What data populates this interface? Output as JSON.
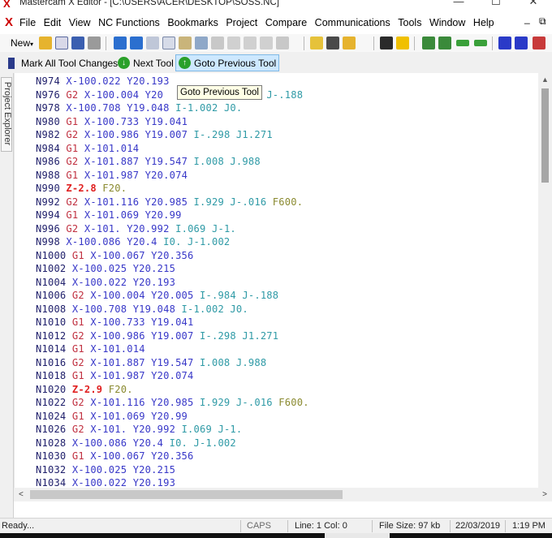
{
  "window": {
    "app_icon_glyph": "X",
    "title": "Mastercam X Editor - [C:\\USERS\\ACER\\DESKTOP\\SOSS.NC]",
    "minimize_glyph": "—",
    "maximize_glyph": "☐",
    "close_glyph": "✕"
  },
  "menubar": {
    "doc_icon_glyph": "X",
    "items": [
      "File",
      "Edit",
      "View",
      "NC Functions",
      "Bookmarks",
      "Project",
      "Compare",
      "Communications",
      "Tools",
      "Window",
      "Help"
    ],
    "doc_minimize_glyph": "_",
    "doc_restore_glyph": "⧉"
  },
  "toolbar": {
    "new_label": "New",
    "new_arrow": "▾"
  },
  "toolbar2": {
    "mark_all_label": "Mark All Tool Changes",
    "next_tool_label": "Next Tool",
    "goto_previous_label": "Goto Previous Tool",
    "next_icon_glyph": "↓",
    "previous_icon_glyph": "↑"
  },
  "tooltip": {
    "text": "Goto Previous Tool"
  },
  "side_panel": {
    "tab_label": "Project Explorer"
  },
  "code": {
    "lines": [
      [
        {
          "t": "N974",
          "c": "c-n"
        },
        {
          "t": " X-100.022",
          "c": "c-x"
        },
        {
          "t": " Y20.193",
          "c": "c-y"
        }
      ],
      [
        {
          "t": "N976",
          "c": "c-n"
        },
        {
          "t": " G2",
          "c": "c-g"
        },
        {
          "t": " X-100.004",
          "c": "c-x"
        },
        {
          "t": " Y20",
          "c": "c-y"
        },
        {
          "t": "                 ",
          "c": "c-n"
        },
        {
          "t": "J-.188",
          "c": "c-i"
        }
      ],
      [
        {
          "t": "N978",
          "c": "c-n"
        },
        {
          "t": " X-100.708",
          "c": "c-x"
        },
        {
          "t": " Y19.048",
          "c": "c-y"
        },
        {
          "t": " I-1.002 J0.",
          "c": "c-i"
        }
      ],
      [
        {
          "t": "N980",
          "c": "c-n"
        },
        {
          "t": " G1",
          "c": "c-g"
        },
        {
          "t": " X-100.733",
          "c": "c-x"
        },
        {
          "t": " Y19.041",
          "c": "c-y"
        }
      ],
      [
        {
          "t": "N982",
          "c": "c-n"
        },
        {
          "t": " G2",
          "c": "c-g"
        },
        {
          "t": " X-100.986",
          "c": "c-x"
        },
        {
          "t": " Y19.007",
          "c": "c-y"
        },
        {
          "t": " I-.298 J1.271",
          "c": "c-i"
        }
      ],
      [
        {
          "t": "N984",
          "c": "c-n"
        },
        {
          "t": " G1",
          "c": "c-g"
        },
        {
          "t": " X-101.014",
          "c": "c-x"
        }
      ],
      [
        {
          "t": "N986",
          "c": "c-n"
        },
        {
          "t": " G2",
          "c": "c-g"
        },
        {
          "t": " X-101.887",
          "c": "c-x"
        },
        {
          "t": " Y19.547",
          "c": "c-y"
        },
        {
          "t": " I.008 J.988",
          "c": "c-i"
        }
      ],
      [
        {
          "t": "N988",
          "c": "c-n"
        },
        {
          "t": " G1",
          "c": "c-g"
        },
        {
          "t": " X-101.987",
          "c": "c-x"
        },
        {
          "t": " Y20.074",
          "c": "c-y"
        }
      ],
      [
        {
          "t": "N990",
          "c": "c-n"
        },
        {
          "t": " Z-2.8",
          "c": "c-z"
        },
        {
          "t": " F20.",
          "c": "c-f"
        }
      ],
      [
        {
          "t": "N992",
          "c": "c-n"
        },
        {
          "t": " G2",
          "c": "c-g"
        },
        {
          "t": " X-101.116",
          "c": "c-x"
        },
        {
          "t": " Y20.985",
          "c": "c-y"
        },
        {
          "t": " I.929 J-.016",
          "c": "c-i"
        },
        {
          "t": " F600.",
          "c": "c-f"
        }
      ],
      [
        {
          "t": "N994",
          "c": "c-n"
        },
        {
          "t": " G1",
          "c": "c-g"
        },
        {
          "t": " X-101.069",
          "c": "c-x"
        },
        {
          "t": " Y20.99",
          "c": "c-y"
        }
      ],
      [
        {
          "t": "N996",
          "c": "c-n"
        },
        {
          "t": " G2",
          "c": "c-g"
        },
        {
          "t": " X-101.",
          "c": "c-x"
        },
        {
          "t": " Y20.992",
          "c": "c-y"
        },
        {
          "t": " I.069 J-1.",
          "c": "c-i"
        }
      ],
      [
        {
          "t": "N998",
          "c": "c-n"
        },
        {
          "t": " X-100.086",
          "c": "c-x"
        },
        {
          "t": " Y20.4",
          "c": "c-y"
        },
        {
          "t": " I0. J-1.002",
          "c": "c-i"
        }
      ],
      [
        {
          "t": "N1000",
          "c": "c-n"
        },
        {
          "t": " G1",
          "c": "c-g"
        },
        {
          "t": " X-100.067",
          "c": "c-x"
        },
        {
          "t": " Y20.356",
          "c": "c-y"
        }
      ],
      [
        {
          "t": "N1002",
          "c": "c-n"
        },
        {
          "t": " X-100.025",
          "c": "c-x"
        },
        {
          "t": " Y20.215",
          "c": "c-y"
        }
      ],
      [
        {
          "t": "N1004",
          "c": "c-n"
        },
        {
          "t": " X-100.022",
          "c": "c-x"
        },
        {
          "t": " Y20.193",
          "c": "c-y"
        }
      ],
      [
        {
          "t": "N1006",
          "c": "c-n"
        },
        {
          "t": " G2",
          "c": "c-g"
        },
        {
          "t": " X-100.004",
          "c": "c-x"
        },
        {
          "t": " Y20.005",
          "c": "c-y"
        },
        {
          "t": " I-.984 J-.188",
          "c": "c-i"
        }
      ],
      [
        {
          "t": "N1008",
          "c": "c-n"
        },
        {
          "t": " X-100.708",
          "c": "c-x"
        },
        {
          "t": " Y19.048",
          "c": "c-y"
        },
        {
          "t": " I-1.002 J0.",
          "c": "c-i"
        }
      ],
      [
        {
          "t": "N1010",
          "c": "c-n"
        },
        {
          "t": " G1",
          "c": "c-g"
        },
        {
          "t": " X-100.733",
          "c": "c-x"
        },
        {
          "t": " Y19.041",
          "c": "c-y"
        }
      ],
      [
        {
          "t": "N1012",
          "c": "c-n"
        },
        {
          "t": " G2",
          "c": "c-g"
        },
        {
          "t": " X-100.986",
          "c": "c-x"
        },
        {
          "t": " Y19.007",
          "c": "c-y"
        },
        {
          "t": " I-.298 J1.271",
          "c": "c-i"
        }
      ],
      [
        {
          "t": "N1014",
          "c": "c-n"
        },
        {
          "t": " G1",
          "c": "c-g"
        },
        {
          "t": " X-101.014",
          "c": "c-x"
        }
      ],
      [
        {
          "t": "N1016",
          "c": "c-n"
        },
        {
          "t": " G2",
          "c": "c-g"
        },
        {
          "t": " X-101.887",
          "c": "c-x"
        },
        {
          "t": " Y19.547",
          "c": "c-y"
        },
        {
          "t": " I.008 J.988",
          "c": "c-i"
        }
      ],
      [
        {
          "t": "N1018",
          "c": "c-n"
        },
        {
          "t": " G1",
          "c": "c-g"
        },
        {
          "t": " X-101.987",
          "c": "c-x"
        },
        {
          "t": " Y20.074",
          "c": "c-y"
        }
      ],
      [
        {
          "t": "N1020",
          "c": "c-n"
        },
        {
          "t": " Z-2.9",
          "c": "c-z"
        },
        {
          "t": " F20.",
          "c": "c-f"
        }
      ],
      [
        {
          "t": "N1022",
          "c": "c-n"
        },
        {
          "t": " G2",
          "c": "c-g"
        },
        {
          "t": " X-101.116",
          "c": "c-x"
        },
        {
          "t": " Y20.985",
          "c": "c-y"
        },
        {
          "t": " I.929 J-.016",
          "c": "c-i"
        },
        {
          "t": " F600.",
          "c": "c-f"
        }
      ],
      [
        {
          "t": "N1024",
          "c": "c-n"
        },
        {
          "t": " G1",
          "c": "c-g"
        },
        {
          "t": " X-101.069",
          "c": "c-x"
        },
        {
          "t": " Y20.99",
          "c": "c-y"
        }
      ],
      [
        {
          "t": "N1026",
          "c": "c-n"
        },
        {
          "t": " G2",
          "c": "c-g"
        },
        {
          "t": " X-101.",
          "c": "c-x"
        },
        {
          "t": " Y20.992",
          "c": "c-y"
        },
        {
          "t": " I.069 J-1.",
          "c": "c-i"
        }
      ],
      [
        {
          "t": "N1028",
          "c": "c-n"
        },
        {
          "t": " X-100.086",
          "c": "c-x"
        },
        {
          "t": " Y20.4",
          "c": "c-y"
        },
        {
          "t": " I0. J-1.002",
          "c": "c-i"
        }
      ],
      [
        {
          "t": "N1030",
          "c": "c-n"
        },
        {
          "t": " G1",
          "c": "c-g"
        },
        {
          "t": " X-100.067",
          "c": "c-x"
        },
        {
          "t": " Y20.356",
          "c": "c-y"
        }
      ],
      [
        {
          "t": "N1032",
          "c": "c-n"
        },
        {
          "t": " X-100.025",
          "c": "c-x"
        },
        {
          "t": " Y20.215",
          "c": "c-y"
        }
      ],
      [
        {
          "t": "N1034",
          "c": "c-n"
        },
        {
          "t": " X-100.022",
          "c": "c-x"
        },
        {
          "t": " Y20.193",
          "c": "c-y"
        }
      ]
    ]
  },
  "scrollbars": {
    "up_glyph": "▲",
    "left_glyph": "<",
    "right_glyph": ">"
  },
  "statusbar": {
    "ready": "Ready...",
    "caps": "CAPS",
    "position": "Line:  1 Col:  0",
    "file_size": "File Size: 97 kb",
    "date": "22/03/2019",
    "time": "1:19 PM"
  },
  "colors": {
    "line_number": "#1f1f6b",
    "g_code": "#c03040",
    "coordinate": "#3838c8",
    "arc_center": "#2f9aa6",
    "z_depth": "#e02020",
    "feed": "#8a8a30",
    "active_button": "#cde8ff"
  }
}
